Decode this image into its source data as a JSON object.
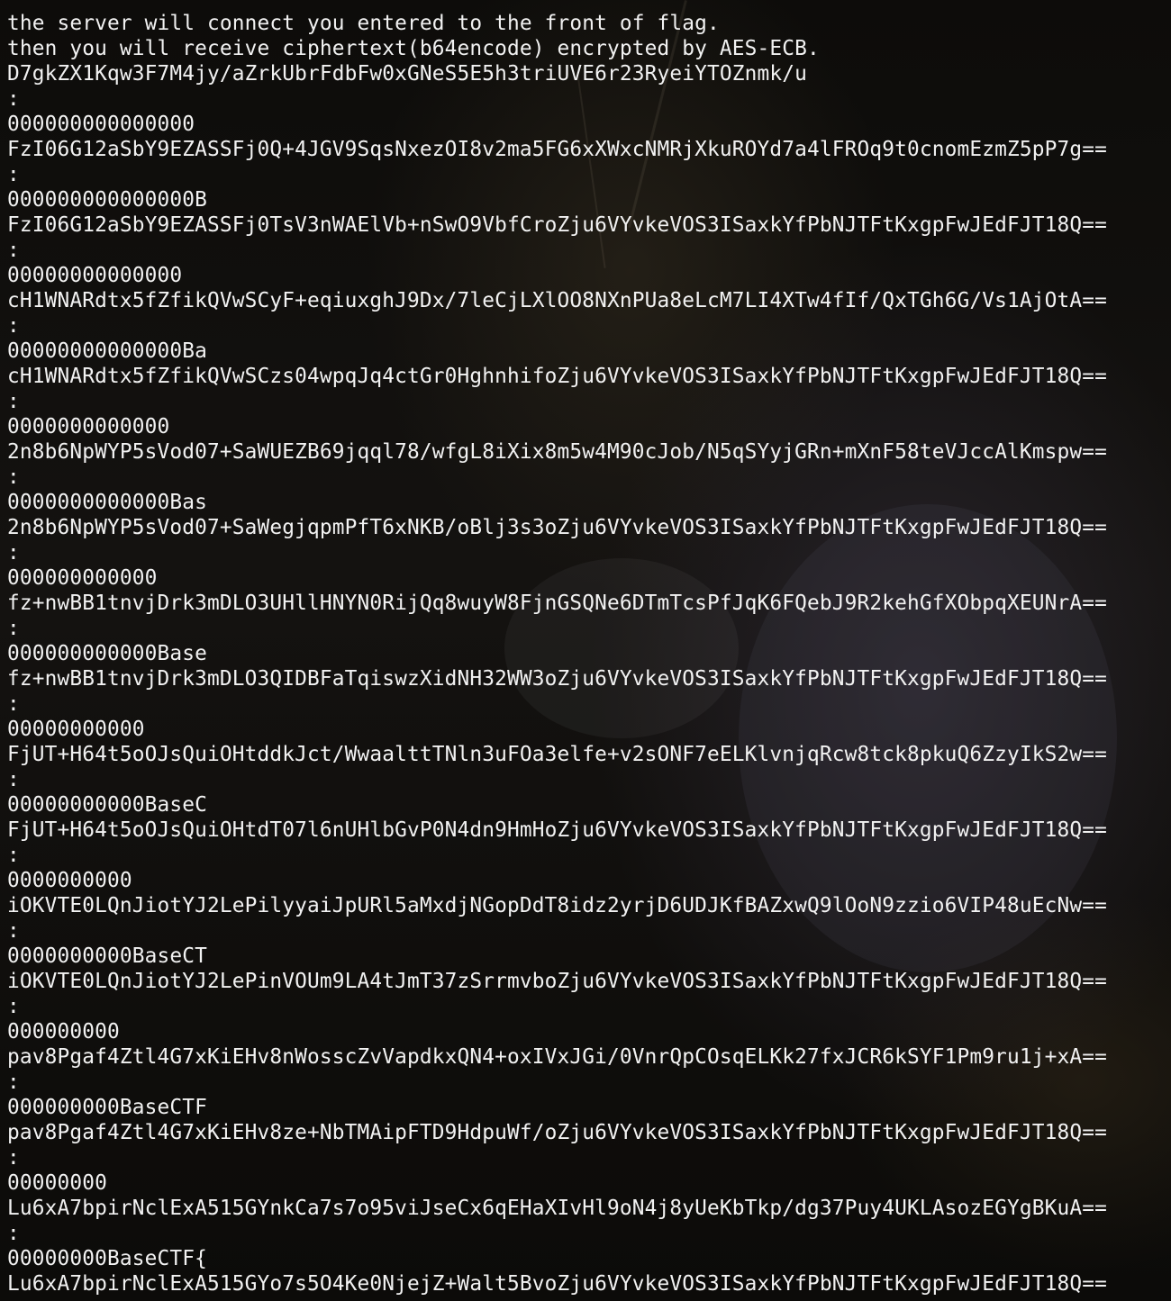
{
  "terminal": {
    "lines": [
      "the server will connect you entered to the front of flag.",
      "then you will receive ciphertext(b64encode) encrypted by AES-ECB.",
      "D7gkZX1Kqw3F7M4jy/aZrkUbrFdbFw0xGNeS5E5h3triUVE6r23RyeiYTOZnmk/u",
      ":",
      "000000000000000",
      "FzI06G12aSbY9EZASSFj0Q+4JGV9SqsNxezOI8v2ma5FG6xXWxcNMRjXkuROYd7a4lFROq9t0cnomEzmZ5pP7g==",
      ":",
      "000000000000000B",
      "FzI06G12aSbY9EZASSFj0TsV3nWAElVb+nSwO9VbfCroZju6VYvkeVOS3ISaxkYfPbNJTFtKxgpFwJEdFJT18Q==",
      ":",
      "00000000000000",
      "cH1WNARdtx5fZfikQVwSCyF+eqiuxghJ9Dx/7leCjLXlOO8NXnPUa8eLcM7LI4XTw4fIf/QxTGh6G/Vs1AjOtA==",
      ":",
      "00000000000000Ba",
      "cH1WNARdtx5fZfikQVwSCzs04wpqJq4ctGr0HghnhifoZju6VYvkeVOS3ISaxkYfPbNJTFtKxgpFwJEdFJT18Q==",
      ":",
      "0000000000000",
      "2n8b6NpWYP5sVod07+SaWUEZB69jqql78/wfgL8iXix8m5w4M90cJob/N5qSYyjGRn+mXnF58teVJccAlKmspw==",
      ":",
      "0000000000000Bas",
      "2n8b6NpWYP5sVod07+SaWegjqpmPfT6xNKB/oBlj3s3oZju6VYvkeVOS3ISaxkYfPbNJTFtKxgpFwJEdFJT18Q==",
      ":",
      "000000000000",
      "fz+nwBB1tnvjDrk3mDLO3UHllHNYN0RijQq8wuyW8FjnGSQNe6DTmTcsPfJqK6FQebJ9R2kehGfXObpqXEUNrA==",
      ":",
      "000000000000Base",
      "fz+nwBB1tnvjDrk3mDLO3QIDBFaTqiswzXidNH32WW3oZju6VYvkeVOS3ISaxkYfPbNJTFtKxgpFwJEdFJT18Q==",
      ":",
      "00000000000",
      "FjUT+H64t5oOJsQuiOHtddkJct/WwaalttTNln3uFOa3elfe+v2sONF7eELKlvnjqRcw8tck8pkuQ6ZzyIkS2w==",
      ":",
      "00000000000BaseC",
      "FjUT+H64t5oOJsQuiOHtdT07l6nUHlbGvP0N4dn9HmHoZju6VYvkeVOS3ISaxkYfPbNJTFtKxgpFwJEdFJT18Q==",
      ":",
      "0000000000",
      "iOKVTE0LQnJiotYJ2LePilyyaiJpURl5aMxdjNGopDdT8idz2yrjD6UDJKfBAZxwQ9lOoN9zzio6VIP48uEcNw==",
      ":",
      "0000000000BaseCT",
      "iOKVTE0LQnJiotYJ2LePinVOUm9LA4tJmT37zSrrmvboZju6VYvkeVOS3ISaxkYfPbNJTFtKxgpFwJEdFJT18Q==",
      ":",
      "000000000",
      "pav8Pgaf4Ztl4G7xKiEHv8nWosscZvVapdkxQN4+oxIVxJGi/0VnrQpCOsqELKk27fxJCR6kSYF1Pm9ru1j+xA==",
      ":",
      "000000000BaseCTF",
      "pav8Pgaf4Ztl4G7xKiEHv8ze+NbTMAipFTD9HdpuWf/oZju6VYvkeVOS3ISaxkYfPbNJTFtKxgpFwJEdFJT18Q==",
      ":",
      "00000000",
      "Lu6xA7bpirNclExA515GYnkCa7s7o95viJseCx6qEHaXIvHl9oN4j8yUeKbTkp/dg37Puy4UKLAsozEGYgBKuA==",
      ":",
      "00000000BaseCTF{",
      "Lu6xA7bpirNclExA515GYo7s5O4Ke0NjejZ+Walt5BvoZju6VYvkeVOS3ISaxkYfPbNJTFtKxgpFwJEdFJT18Q=="
    ]
  }
}
